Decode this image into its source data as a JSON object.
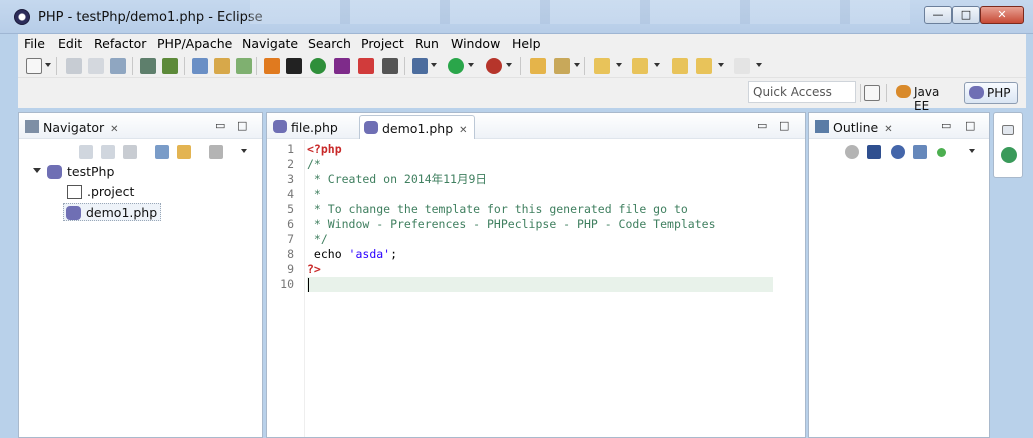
{
  "window": {
    "title": "PHP - testPhp/demo1.php - Eclipse"
  },
  "menu": [
    "File",
    "Edit",
    "Refactor",
    "PHP/Apache",
    "Navigate",
    "Search",
    "Project",
    "Run",
    "Window",
    "Help"
  ],
  "quick_access": {
    "placeholder": "Quick Access"
  },
  "perspectives": {
    "java_ee": "Java EE",
    "php": "PHP"
  },
  "navigator": {
    "tab_label": "Navigator",
    "project": "testPhp",
    "files": [
      ".project",
      "demo1.php"
    ]
  },
  "editor": {
    "tabs": [
      "file.php",
      "demo1.php"
    ],
    "active_tab": "demo1.php",
    "line_numbers": [
      "1",
      "2",
      "3",
      "4",
      "5",
      "6",
      "7",
      "8",
      "9",
      "10"
    ],
    "lines": {
      "l1": "<?php",
      "l2": "/*",
      "l3": " * Created on 2014年11月9日",
      "l4": " *",
      "l5": " * To change the template for this generated file go to",
      "l6": " * Window - Preferences - PHPeclipse - PHP - Code Templates",
      "l7": " */",
      "l8_kw": " echo ",
      "l8_str": "'asda'",
      "l8_end": ";",
      "l9": "?>",
      "l10": ""
    }
  },
  "outline": {
    "tab_label": "Outline"
  },
  "colors": {
    "titlebar": "#b9d1ea",
    "php_tag": "#c82828",
    "comment": "#3f7f5f",
    "string": "#2a00ff",
    "current_line": "#e8f2ea"
  }
}
